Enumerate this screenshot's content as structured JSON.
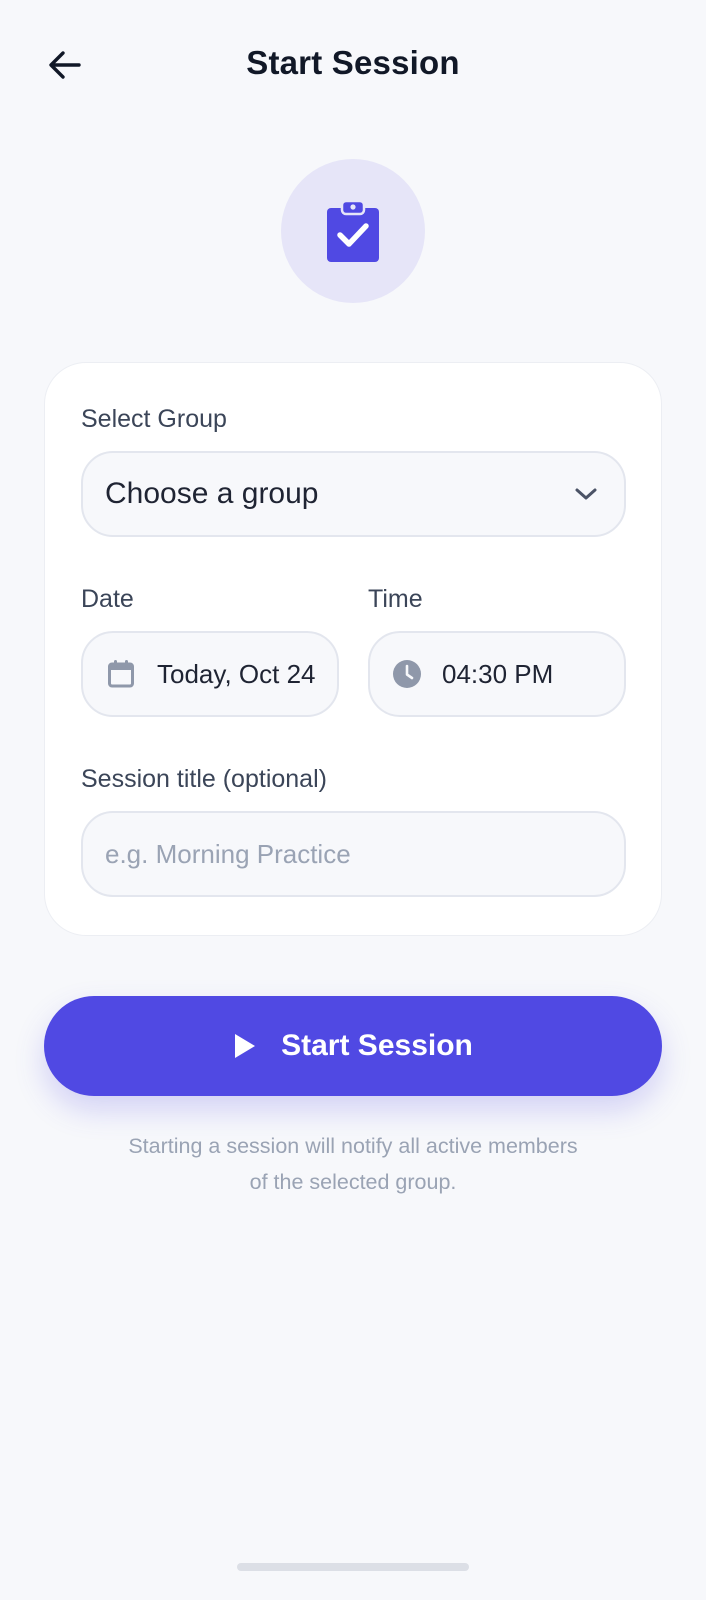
{
  "header": {
    "title": "Start Session",
    "back_icon": "arrow-left-icon"
  },
  "hero": {
    "icon": "clipboard-check-icon",
    "accent": "#5049e3",
    "background": "#e6e5f8"
  },
  "form": {
    "group": {
      "label": "Select Group",
      "value": "Choose a group",
      "icon": "chevron-down-icon"
    },
    "date": {
      "label": "Date",
      "value": "Today, Oct 24",
      "icon": "calendar-icon"
    },
    "time": {
      "label": "Time",
      "value": "04:30 PM",
      "icon": "clock-icon"
    },
    "title": {
      "label": "Session title (optional)",
      "placeholder": "e.g. Morning Practice",
      "value": ""
    }
  },
  "actions": {
    "start_label": "Start Session",
    "start_icon": "play-icon",
    "start_color": "#5049e3"
  },
  "helper": {
    "line1": "Starting a session will notify all active members",
    "line2": "of the selected group."
  }
}
